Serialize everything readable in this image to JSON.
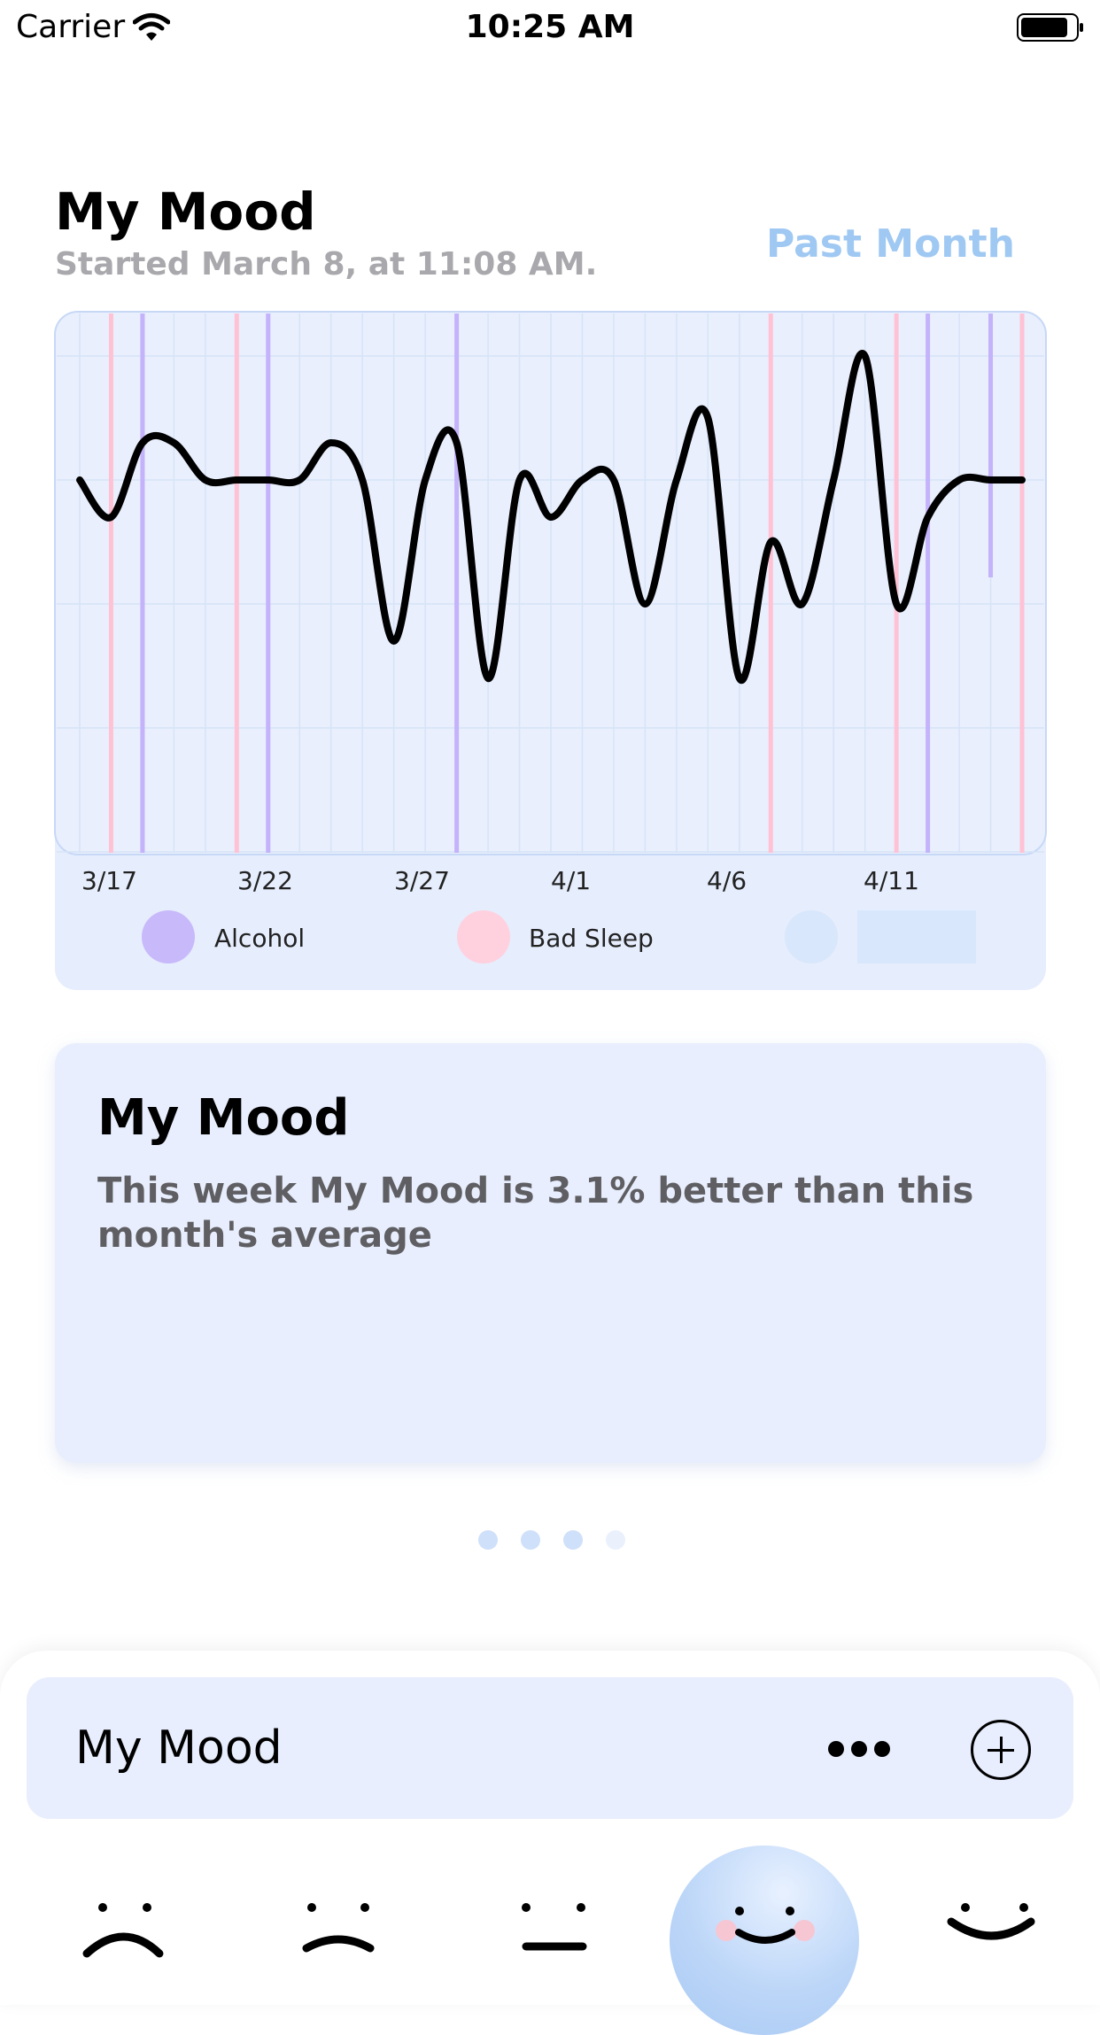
{
  "status_bar": {
    "carrier": "Carrier",
    "time": "10:25 AM"
  },
  "header": {
    "title": "My Mood",
    "subtitle": "Started March 8, at 11:08 AM.",
    "range_button": "Past Month"
  },
  "chart_data": {
    "type": "line",
    "series": [
      {
        "values": [
          3,
          2.7,
          3.3,
          3.3,
          3,
          3,
          3,
          3,
          3.3,
          3,
          1.7,
          3,
          3.3,
          1.4,
          3,
          2.7,
          3,
          3,
          2,
          3,
          3.5,
          1.4,
          2.5,
          2,
          3,
          4,
          2,
          2.7,
          3,
          3,
          3
        ]
      }
    ],
    "x_tick_labels": [
      "3/17",
      "3/22",
      "3/27",
      "4/1",
      "4/6",
      "4/11"
    ],
    "event_markers": {
      "alcohol": [
        "3/18",
        "3/22",
        "3/28",
        "4/12"
      ],
      "bad_sleep": [
        "3/17",
        "3/21",
        "4/7",
        "4/11",
        "4/15"
      ],
      "third_partial": [
        "4/14"
      ]
    },
    "legend": [
      "Alcohol",
      "Bad Sleep",
      ""
    ],
    "grid": true
  },
  "colors": {
    "alcohol": "#c8b9fb",
    "bad_sleep": "#ffd1de",
    "third": "#d8e7fb",
    "accent": "#9fc8f2",
    "card": "#e6edfd"
  },
  "insight": {
    "title": "My Mood",
    "text": "This week My Mood is 3.1% better than this month's average"
  },
  "pager": {
    "count": 4,
    "active_index": 3
  },
  "sheet": {
    "title": "My Mood",
    "more_icon": "more-horizontal-icon",
    "add_icon": "plus-circle-icon",
    "mood_faces": [
      "sad-face-icon",
      "frown-face-icon",
      "neutral-face-icon",
      "happy-face-icon",
      "smile-face-icon"
    ]
  }
}
